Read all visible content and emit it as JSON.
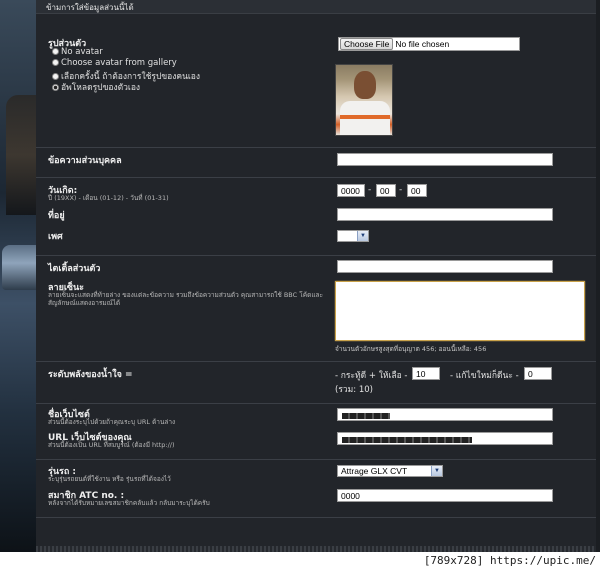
{
  "panel": {
    "title": "ข้ามการใส่ข้อมูลส่วนนี้ได้"
  },
  "avatar": {
    "label": "รูปส่วนตัว",
    "options": [
      "No avatar",
      "Choose avatar from gallery",
      "เลือกครั้งนี้ ถ้าต้องการใช้รูปของคนเอง",
      "อัพโหลดรูปของตัวเอง"
    ],
    "selected_index": 3,
    "file_button": "Choose File",
    "file_status": "No file chosen"
  },
  "personal_message": {
    "label": "ข้อความส่วนบุคคล",
    "value": ""
  },
  "birthday": {
    "label": "วันเกิด:",
    "hint": "ปี (19XX) - เดือน (01-12) - วันที่ (01-31)",
    "year": "0000",
    "month": "00",
    "day": "00",
    "separator": "-"
  },
  "location": {
    "label": "ที่อยู่",
    "value": ""
  },
  "gender": {
    "label": "เพศ",
    "value": ""
  },
  "custom_title": {
    "label": "ไตเติ้ลส่วนตัว",
    "value": ""
  },
  "signature": {
    "label": "ลายเซ็นะ",
    "desc_line1": "ลายเซ็นจะแสดงที่ท้ายล่าง ของแต่ละข้อความ รวมถึงข้อความส่วนตัว คุณสามารถใช้ BBC โค้ดและ",
    "desc_line2": "สัญลักษณ์แสดงอารมณ์ได้",
    "chars_note": "จำนวนตัวอักษรสูงสุดที่อนุญาต 456; ออนนี้เหลือ: 456"
  },
  "reputation": {
    "label": "ระดับพลังของน้ำใจ =",
    "plus_text": "- กระทู้ดี + ให้เลือ -",
    "plus_value": "10",
    "minus_text": "- แก้ไขใหม่ก็ดีนะ -",
    "minus_value": "0",
    "total": "(รวม: 10)"
  },
  "website_name": {
    "label": "ชื่อเว็บไซต์",
    "desc": "ส่วนนี้ต้องระบุไปด้วยถ้าคุณระบุ URL ด้านล่าง"
  },
  "website_url": {
    "label": "URL เว็บไซต์ของคุณ",
    "desc": "ส่วนนี้ต้องเป็น URL ที่สมบูรณ์ (ต้องมี http://)"
  },
  "car_model": {
    "label": "รุ่นรถ :",
    "desc": "ระบุรุ่นรถยนต์ที่ใช้งาน หรือ รุ่นรถที่ได้จองไว้",
    "value": "Attrage GLX CVT"
  },
  "atc_member": {
    "label": "สมาชิก ATC no. :",
    "desc": "หลังจากได้รับหมายเลขสมาชิกคลับแล้ว กลับมาระบุได้ครับ",
    "value": "0000"
  },
  "watermark": {
    "text": "[789x728] https://upic.me/"
  }
}
